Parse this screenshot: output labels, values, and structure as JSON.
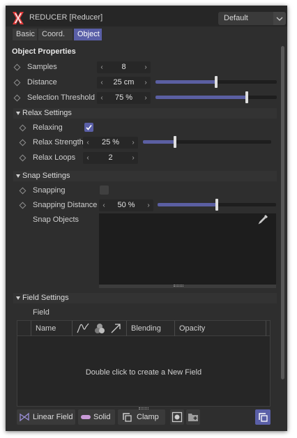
{
  "window": {
    "title": "REDUCER [Reducer]",
    "preset": "Default"
  },
  "tabs": [
    {
      "label": "Basic"
    },
    {
      "label": "Coord."
    },
    {
      "label": "Object"
    }
  ],
  "object_properties": {
    "heading": "Object Properties",
    "samples": {
      "label": "Samples",
      "value": "8"
    },
    "distance": {
      "label": "Distance",
      "value": "25 cm",
      "level": 0.5
    },
    "selection_threshold": {
      "label": "Selection Threshold",
      "value": "75 %",
      "level": 0.75
    }
  },
  "relax": {
    "heading": "Relax Settings",
    "relaxing": {
      "label": "Relaxing",
      "checked": true
    },
    "strength": {
      "label": "Relax Strength",
      "value": "25 %",
      "level": 0.25
    },
    "loops": {
      "label": "Relax Loops",
      "value": "2"
    }
  },
  "snap": {
    "heading": "Snap Settings",
    "snapping": {
      "label": "Snapping",
      "checked": false
    },
    "distance": {
      "label": "Snapping Distance",
      "value": "50 %",
      "level": 0.5
    },
    "objects": {
      "label": "Snap Objects"
    }
  },
  "field": {
    "heading": "Field Settings",
    "label": "Field",
    "columns": {
      "name": "Name",
      "blending": "Blending",
      "opacity": "Opacity"
    },
    "empty_message": "Double click to create a New Field"
  },
  "toolbar": {
    "linear_field": "Linear Field",
    "solid": "Solid",
    "clamp": "Clamp"
  },
  "colors": {
    "accent": "#5a5fa7",
    "background": "#2e2e2e",
    "field_bg": "#1d1d1d"
  },
  "icons": [
    "reducer-app-icon",
    "chevron-down-icon",
    "diamond-keyframe-icon",
    "checkmark-icon",
    "eyedropper-icon",
    "curve-icon",
    "layers-icon",
    "arrow-icon",
    "linear-field-icon",
    "solid-icon",
    "clamp-icon",
    "record-icon",
    "folder-add-icon",
    "new-layer-icon"
  ]
}
